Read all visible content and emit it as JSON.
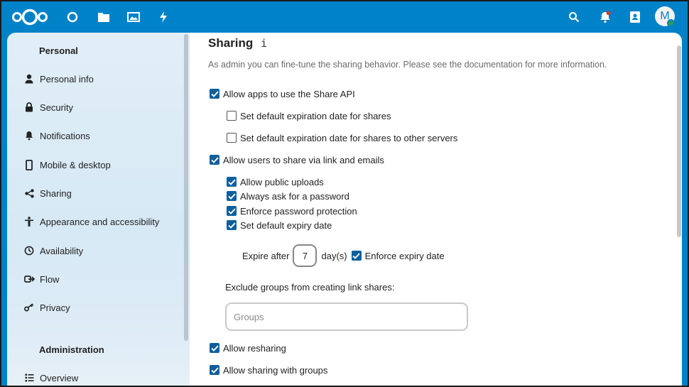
{
  "header": {
    "icons": [
      "nextcloud-logo",
      "dashboard-icon",
      "files-icon",
      "photos-icon",
      "activity-icon",
      "search-icon",
      "notifications-icon",
      "contacts-icon"
    ],
    "avatar_letter": "M",
    "status_color": "#2d9c4f",
    "brand_color": "#0082c9"
  },
  "sidebar": {
    "personal_heading": "Personal",
    "personal_items": [
      {
        "label": "Personal info",
        "icon": "person-icon"
      },
      {
        "label": "Security",
        "icon": "lock-icon"
      },
      {
        "label": "Notifications",
        "icon": "bell-icon"
      },
      {
        "label": "Mobile & desktop",
        "icon": "phone-icon"
      },
      {
        "label": "Sharing",
        "icon": "share-icon"
      },
      {
        "label": "Appearance and accessibility",
        "icon": "accessibility-icon"
      },
      {
        "label": "Availability",
        "icon": "clock-icon"
      },
      {
        "label": "Flow",
        "icon": "flow-icon"
      },
      {
        "label": "Privacy",
        "icon": "key-icon"
      }
    ],
    "admin_heading": "Administration",
    "admin_items": [
      {
        "label": "Overview",
        "icon": "list-icon"
      }
    ]
  },
  "main": {
    "title": "Sharing",
    "info_glyph": "i",
    "description": "As admin you can fine-tune the sharing behavior. Please see the documentation for more information.",
    "options": {
      "share_api": {
        "label": "Allow apps to use the Share API",
        "checked": true
      },
      "default_expiration": {
        "label": "Set default expiration date for shares",
        "checked": false
      },
      "default_expiration_remote": {
        "label": "Set default expiration date for shares to other servers",
        "checked": false
      },
      "link_share": {
        "label": "Allow users to share via link and emails",
        "checked": true
      },
      "public_uploads": {
        "label": "Allow public uploads",
        "checked": true
      },
      "ask_password": {
        "label": "Always ask for a password",
        "checked": true
      },
      "enforce_password": {
        "label": "Enforce password protection",
        "checked": true
      },
      "default_expiry": {
        "label": "Set default expiry date",
        "checked": true
      },
      "resharing": {
        "label": "Allow resharing",
        "checked": true
      },
      "sharing_groups": {
        "label": "Allow sharing with groups",
        "checked": true
      }
    },
    "expire": {
      "prefix": "Expire after",
      "days_value": "7",
      "unit": "day(s)",
      "enforce_label": "Enforce expiry date",
      "enforce_checked": true
    },
    "exclude_groups": {
      "label": "Exclude groups from creating link shares:",
      "placeholder": "Groups"
    }
  }
}
